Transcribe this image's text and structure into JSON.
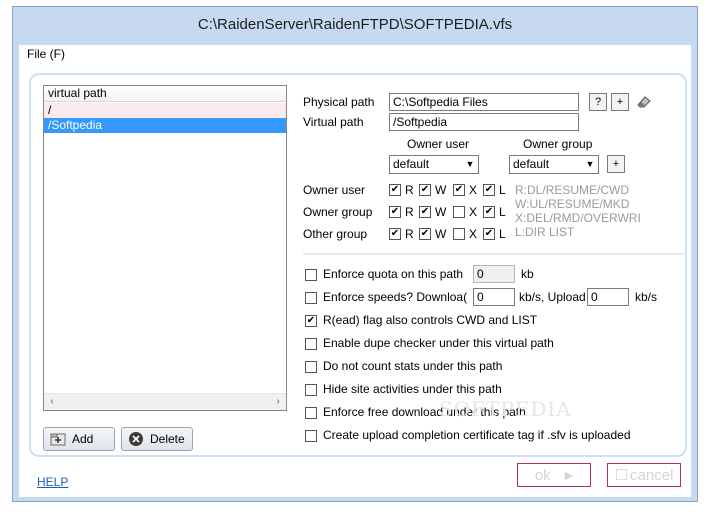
{
  "window": {
    "title": "C:\\RaidenServer\\RaidenFTPD\\SOFTPEDIA.vfs"
  },
  "menu": {
    "file": "File (F)"
  },
  "vpath_list": {
    "header": "virtual path",
    "rows": [
      "/",
      "/Softpedia"
    ],
    "selected_index": 1
  },
  "buttons": {
    "add": "Add",
    "delete": "Delete",
    "ok": "ok",
    "cancel": "cancel"
  },
  "paths": {
    "physical_label": "Physical path",
    "physical_value": "C:\\Softpedia Files",
    "virtual_label": "Virtual path",
    "virtual_value": "/Softpedia"
  },
  "owner": {
    "user_header": "Owner user",
    "group_header": "Owner group",
    "user_value": "default",
    "group_value": "default",
    "plus": "+"
  },
  "permissions": {
    "rows": [
      {
        "label": "Owner user",
        "R": true,
        "W": true,
        "X": true,
        "L": true
      },
      {
        "label": "Owner group",
        "R": true,
        "W": true,
        "X": false,
        "L": true
      },
      {
        "label": "Other group",
        "R": true,
        "W": true,
        "X": false,
        "L": true
      }
    ],
    "letters": {
      "r": "R",
      "w": "W",
      "x": "X",
      "l": "L"
    },
    "legend": [
      "R:DL/RESUME/CWD",
      "W:UL/RESUME/MKD",
      "X:DEL/RMD/OVERWRI",
      "L:DIR LIST"
    ]
  },
  "options": {
    "quota_label": "Enforce quota on this path",
    "quota_value": "0",
    "quota_unit": "kb",
    "speed_label": "Enforce speeds?  Downloa(",
    "download_value": "0",
    "upload_label": "kb/s, Upload",
    "upload_value": "0",
    "upload_unit": "kb/s",
    "items": [
      {
        "label": "R(ead) flag also controls CWD and LIST",
        "checked": true
      },
      {
        "label": "Enable dupe checker under this virtual path",
        "checked": false
      },
      {
        "label": "Do not count stats under this path",
        "checked": false
      },
      {
        "label": "Hide site activities under this path",
        "checked": false
      },
      {
        "label": "Enforce free download under this path",
        "checked": false
      },
      {
        "label": "Create upload completion certificate tag if .sfv is uploaded",
        "checked": false
      }
    ]
  },
  "help": "HELP",
  "watermark": "SOFTPEDIA",
  "icons": {
    "help_square": "?",
    "add_square": "+",
    "check": "✔",
    "arrow_left": "‹",
    "arrow_right": "›",
    "ok_arrow": "▶",
    "cancel_box": "☐"
  }
}
